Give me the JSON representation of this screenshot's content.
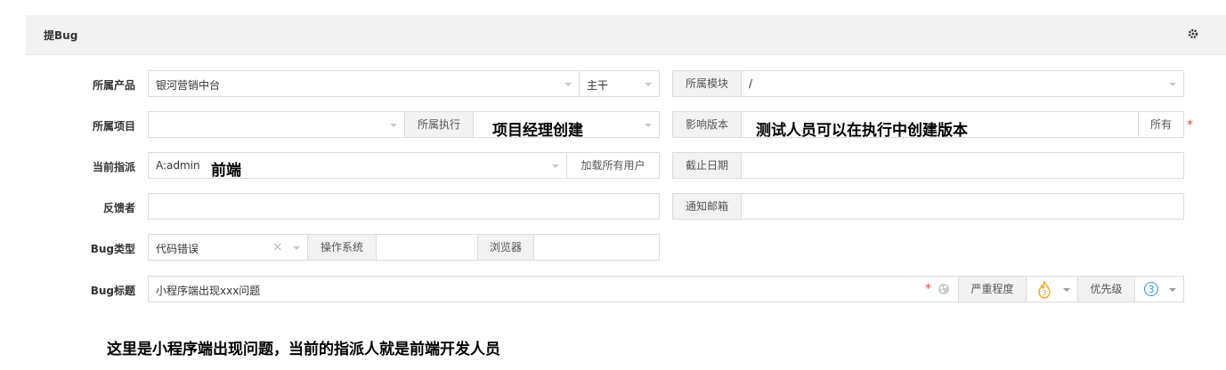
{
  "panel": {
    "title": "提Bug"
  },
  "labels": {
    "product": "所属产品",
    "project": "所属项目",
    "assign": "当前指派",
    "feedback": "反馈者",
    "bug_type": "Bug类型",
    "bug_title": "Bug标题"
  },
  "product": {
    "value": "银河营销中台",
    "branch": "主干"
  },
  "module": {
    "label": "所属模块",
    "value": "/"
  },
  "project": {
    "value": "",
    "exec_label": "所属执行",
    "exec_value": ""
  },
  "version": {
    "label": "影响版本",
    "all_button": "所有"
  },
  "assign": {
    "value": "A:admin",
    "load_all": "加载所有用户"
  },
  "deadline": {
    "label": "截止日期",
    "value": ""
  },
  "notify": {
    "label": "通知邮箱",
    "value": ""
  },
  "bug_type": {
    "value": "代码错误",
    "os_label": "操作系统",
    "os_value": "",
    "browser_label": "浏览器",
    "browser_value": ""
  },
  "bug_title": {
    "value": "小程序端出现xxx问题",
    "severity_label": "严重程度",
    "severity_value": "3",
    "priority_label": "优先级",
    "priority_value": "3"
  },
  "annotations": {
    "exec": "项目经理创建",
    "version": "测试人员可以在执行中创建版本",
    "assign": "前端",
    "bottom": "这里是小程序端出现问题，当前的指派人就是前端开发人员"
  },
  "colors": {
    "header_bg": "#f2f2f2",
    "required": "#e04545",
    "priority_blue": "#2e90e8",
    "severity_orange": "#f5a623"
  },
  "icons": {
    "settings": "gear-icon",
    "dropdown": "chevron-down-icon",
    "clear": "close-icon",
    "color": "palette-icon",
    "severity": "fire-icon"
  }
}
